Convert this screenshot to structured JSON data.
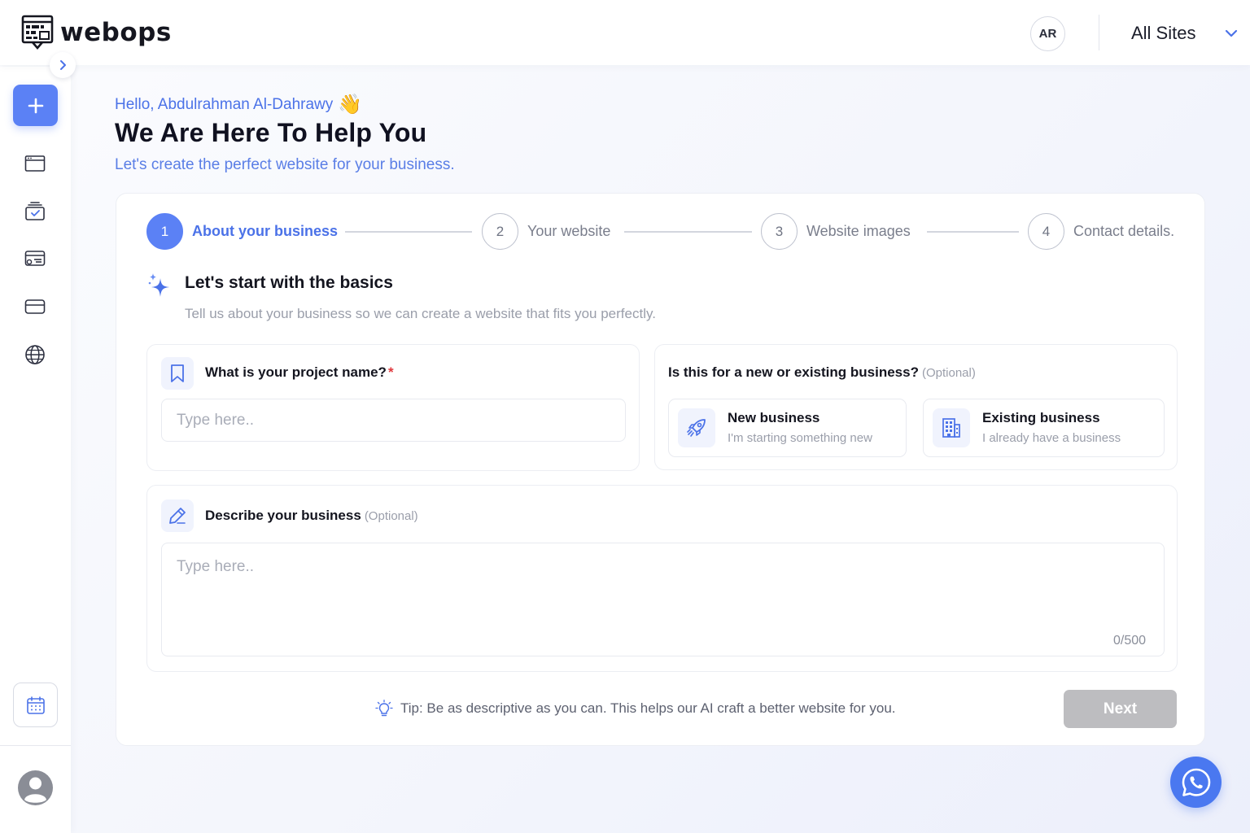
{
  "header": {
    "brand_name": "webops",
    "user_initials": "AR",
    "site_selector": "All Sites"
  },
  "sidebar": {
    "icons": [
      "browser-window-icon",
      "checklist-icon",
      "payment-card-icon",
      "credit-card-icon",
      "globe-icon",
      "calendar-icon",
      "user-icon"
    ]
  },
  "main": {
    "greeting": "Hello, Abdulrahman Al-Dahrawy",
    "greeting_emoji": "👋",
    "title": "We Are Here To Help You",
    "subtitle": "Let's create the perfect website for your business."
  },
  "stepper": {
    "steps": [
      {
        "number": "1",
        "label": "About your business"
      },
      {
        "number": "2",
        "label": "Your website"
      },
      {
        "number": "3",
        "label": "Website images"
      },
      {
        "number": "4",
        "label": "Contact details."
      }
    ],
    "active_step": 1
  },
  "basics": {
    "title": "Let's start with the basics",
    "description": "Tell us about your business so we can create a website that fits you perfectly."
  },
  "project_name": {
    "label": "What is your project name?",
    "required_mark": "*",
    "placeholder": "Type here..",
    "value": ""
  },
  "business_type": {
    "label": "Is this for a new or existing business?",
    "optional_tag": "(Optional)",
    "options": [
      {
        "title": "New business",
        "subtitle": "I'm starting something new"
      },
      {
        "title": "Existing business",
        "subtitle": "I already have a business"
      }
    ]
  },
  "description": {
    "label": "Describe your business",
    "optional_tag": "(Optional)",
    "placeholder": "Type here..",
    "value": "",
    "counter": "0/500"
  },
  "footer": {
    "tip": "Tip: Be as descriptive as you can. This helps our AI craft a better website for you.",
    "next_label": "Next"
  },
  "colors": {
    "accent": "#5b81f5",
    "accent_text": "#4b72e8",
    "disabled_button": "#bdbdc0",
    "required": "#e0393e"
  }
}
